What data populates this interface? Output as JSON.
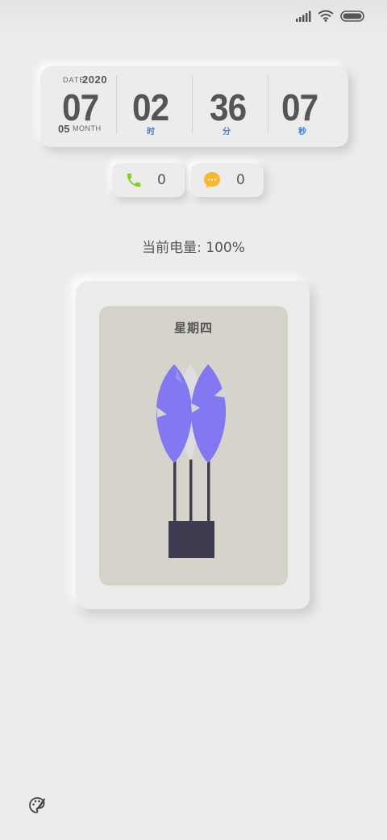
{
  "status_bar": {
    "icons": [
      "signal-icon",
      "wifi-icon",
      "battery-icon"
    ]
  },
  "clock": {
    "date_label": "DATE:",
    "year": "2020",
    "day": "07",
    "month": "05",
    "month_label": "MONTH",
    "hour": "02",
    "hour_unit": "时",
    "minute": "36",
    "minute_unit": "分",
    "second": "07",
    "second_unit": "秒"
  },
  "counters": {
    "missed_calls": "0",
    "unread_messages": "0"
  },
  "battery": {
    "text": "当前电量: 100%"
  },
  "weekday_card": {
    "weekday": "星期四"
  },
  "colors": {
    "accent_blue": "#3b7de6",
    "phone_green": "#7ed321",
    "message_yellow": "#f5b82e",
    "leaf_purple": "#8279f2",
    "pot_dark": "#3f3c52",
    "card_inner": "#d6d3cb"
  },
  "bottom": {
    "theme_icon": "palette-icon"
  }
}
